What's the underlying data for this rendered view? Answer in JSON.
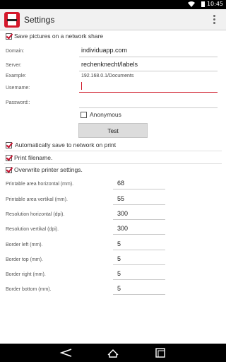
{
  "status_bar": {
    "time": "10:45"
  },
  "action_bar": {
    "title": "Settings"
  },
  "network": {
    "save_network_label": "Save pictures on a network share",
    "domain_label": "Domain:",
    "domain_value": "individuapp.com",
    "server_label": "Server:",
    "server_value": "rechenknecht/labels",
    "example_label": "Example:",
    "example_value": "192.168.0.1/Documents",
    "username_label": "Username:",
    "username_value": "",
    "password_label": "Password::",
    "password_value": "",
    "anonymous_label": "Anonymous",
    "test_button_label": "Test",
    "auto_save_label": "Automatically save to network on print"
  },
  "printing": {
    "print_filename_label": "Print filename.",
    "overwrite_label": "Overwrite printer settings.",
    "fields": [
      {
        "label": "Printable area horizontal (mm).",
        "value": "68"
      },
      {
        "label": "Printable area vertikal (mm).",
        "value": "55"
      },
      {
        "label": "Resolution horizontal (dpi).",
        "value": "300"
      },
      {
        "label": "Resolution vertikal (dpi).",
        "value": "300"
      },
      {
        "label": "Border left (mm).",
        "value": "5"
      },
      {
        "label": "Border top (mm).",
        "value": "5"
      },
      {
        "label": "Border right (mm).",
        "value": "5"
      },
      {
        "label": "Border bottom (mm).",
        "value": "5"
      }
    ]
  },
  "colors": {
    "accent": "#d01c2c",
    "action_bar": "#f1f1f1"
  }
}
